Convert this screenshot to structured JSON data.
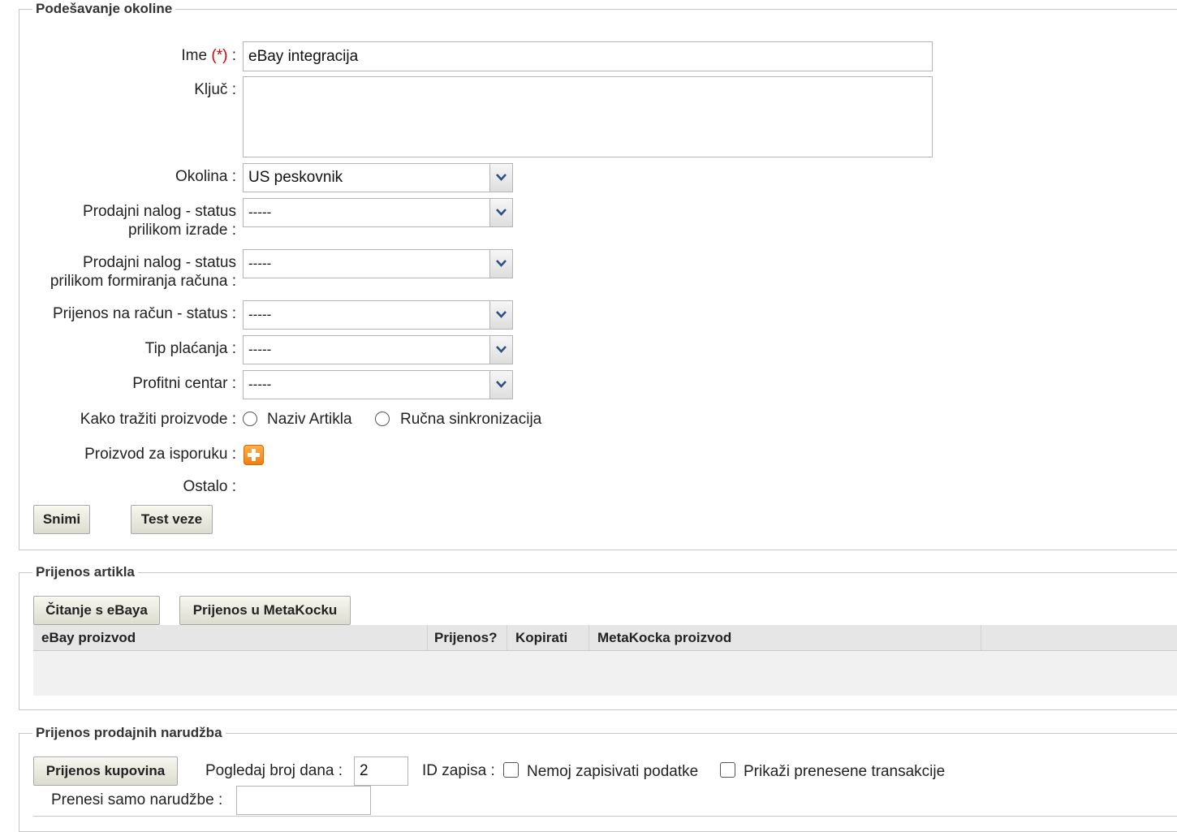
{
  "env": {
    "legend": "Podešavanje okoline",
    "name_label": "Ime",
    "name_required": "(*)",
    "name_suffix": ":",
    "name_value": "eBay integracija",
    "key_label": "Ključ :",
    "key_value": "",
    "env_label": "Okolina :",
    "env_value": "US peskovnik",
    "so_create_label_1": "Prodajni nalog - status",
    "so_create_label_2": "prilikom izrade :",
    "so_create_value": "-----",
    "so_invoice_label_1": "Prodajni nalog - status",
    "so_invoice_label_2": "prilikom formiranja računa :",
    "so_invoice_value": "-----",
    "transfer_status_label": "Prijenos na račun - status :",
    "transfer_status_value": "-----",
    "payment_type_label": "Tip plaćanja :",
    "payment_type_value": "-----",
    "profit_center_label": "Profitni centar :",
    "profit_center_value": "-----",
    "search_label": "Kako tražiti proizvode :",
    "search_options": [
      "Naziv Artikla",
      "Ručna sinkronizacija"
    ],
    "shipping_label": "Proizvod za isporuku :",
    "other_label": "Ostalo :",
    "save_button": "Snimi",
    "test_button": "Test veze"
  },
  "items": {
    "legend": "Prijenos artikla",
    "read_button": "Čitanje s eBaya",
    "transfer_button": "Prijenos u MetaKocku",
    "columns": [
      "eBay proizvod",
      "Prijenos?",
      "Kopirati",
      "MetaKocka proizvod",
      ""
    ]
  },
  "orders": {
    "legend": "Prijenos prodajnih narudžba",
    "purchases_button": "Prijenos kupovina",
    "days_label": "Pogledaj broj dana :",
    "days_value": "2",
    "id_label": "ID zapisa :",
    "no_write_label": "Nemoj zapisivati podatke",
    "show_transferred_label": "Prikaži prenesene transakcije",
    "only_orders_label": "Prenesi samo narudžbe :",
    "only_orders_value": ""
  }
}
